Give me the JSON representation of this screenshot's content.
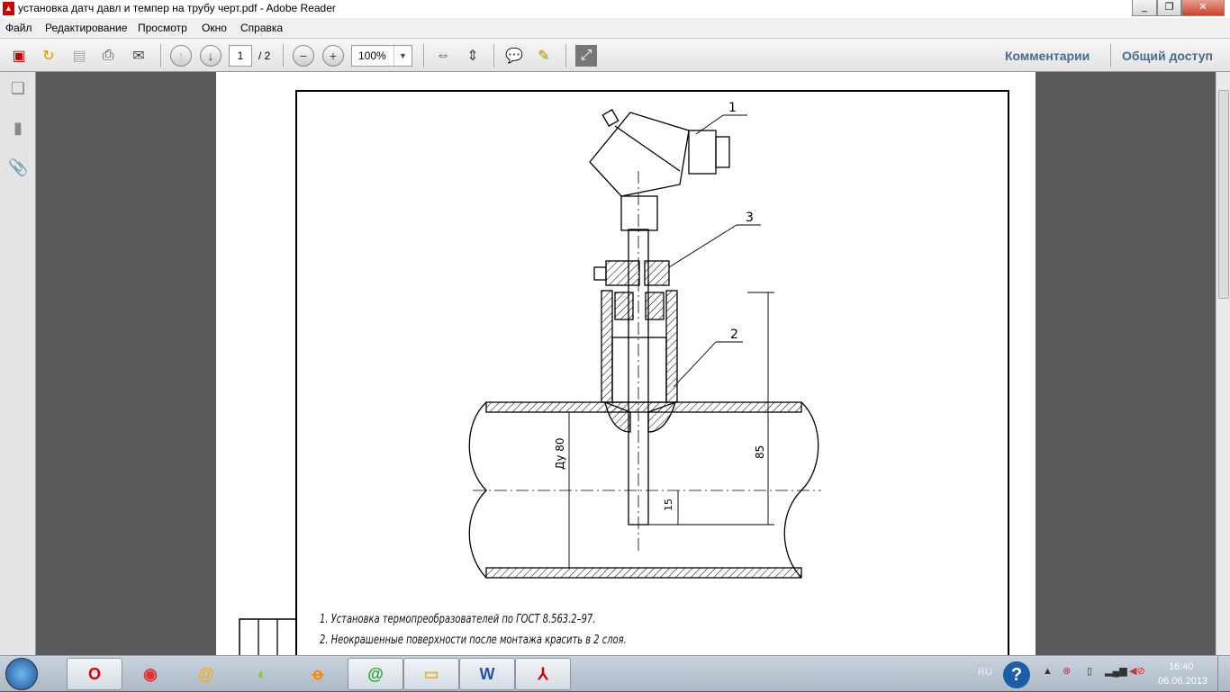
{
  "window": {
    "title": "установка датч давл и темпер на трубу черт.pdf - Adobe Reader",
    "minimize": "_",
    "restore": "❐",
    "close": "✕"
  },
  "menu": [
    "Файл",
    "Редактирование",
    "Просмотр",
    "Окно",
    "Справка"
  ],
  "toolbar": {
    "page_current": "1",
    "page_total": "/ 2",
    "zoom": "100%",
    "comments": "Комментарии",
    "share": "Общий доступ"
  },
  "drawing": {
    "callouts": [
      "1",
      "2",
      "3"
    ],
    "dim_du": "Ду 80",
    "dim_85": "85",
    "dim_15": "15"
  },
  "notes": [
    "1. Установка термопреобразователей по ГОСТ 8.563.2–97.",
    "2. Неокрашенные поверхности после монтажа красить в 2 слоя."
  ],
  "tray": {
    "lang": "RU",
    "time": "16:40",
    "date": "06.06.2013"
  }
}
